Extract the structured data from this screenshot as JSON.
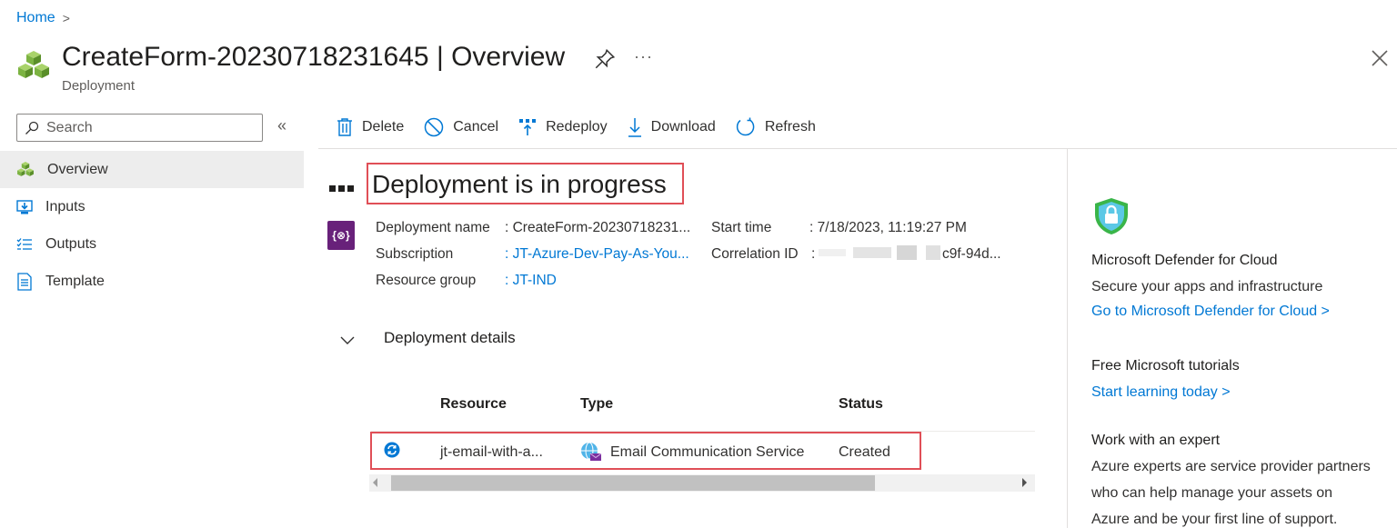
{
  "breadcrumb": {
    "home": "Home",
    "separator": ">"
  },
  "header": {
    "title_name": "CreateForm-20230718231645",
    "title_separator": "|",
    "title_section": "Overview",
    "subtitle": "Deployment",
    "more": "···"
  },
  "sidebar": {
    "search_placeholder": "Search",
    "collapse": "«",
    "items": [
      {
        "label": "Overview",
        "icon": "deployment-cubes-icon"
      },
      {
        "label": "Inputs",
        "icon": "inputs-icon"
      },
      {
        "label": "Outputs",
        "icon": "outputs-list-icon"
      },
      {
        "label": "Template",
        "icon": "template-document-icon"
      }
    ]
  },
  "toolbar": {
    "delete": "Delete",
    "cancel": "Cancel",
    "redeploy": "Redeploy",
    "download": "Download",
    "refresh": "Refresh"
  },
  "main": {
    "heading": "Deployment is in progress",
    "deployment_name_label": "Deployment name",
    "deployment_name_value": ": CreateForm-20230718231...",
    "subscription_label": "Subscription",
    "subscription_value": ": JT-Azure-Dev-Pay-As-You...",
    "resource_group_label": "Resource group",
    "resource_group_value": ": JT-IND",
    "start_time_label": "Start time",
    "start_time_value": ": 7/18/2023, 11:19:27 PM",
    "correlation_id_label": "Correlation ID",
    "correlation_id_colon": ":",
    "correlation_id_value": "c9f-94d...",
    "details_title": "Deployment details",
    "table": {
      "headers": {
        "resource": "Resource",
        "type": "Type",
        "status": "Status"
      },
      "rows": [
        {
          "resource": "jt-email-with-a...",
          "type": "Email Communication Service",
          "status": "Created"
        }
      ]
    }
  },
  "right_panel": {
    "defender_title": "Microsoft Defender for Cloud",
    "defender_text": "Secure your apps and infrastructure",
    "defender_link": "Go to Microsoft Defender for Cloud >",
    "tutorials_title": "Free Microsoft tutorials",
    "tutorials_link": "Start learning today >",
    "expert_title": "Work with an expert",
    "expert_line1": "Azure experts are service provider partners",
    "expert_line2": "who can help manage your assets on",
    "expert_line3": "Azure and be your first line of support."
  },
  "colors": {
    "accent": "#0078d4",
    "highlight_border": "#e04f57",
    "deploy_icon_bg": "#68217a",
    "nav_active_bg": "#ededed"
  }
}
